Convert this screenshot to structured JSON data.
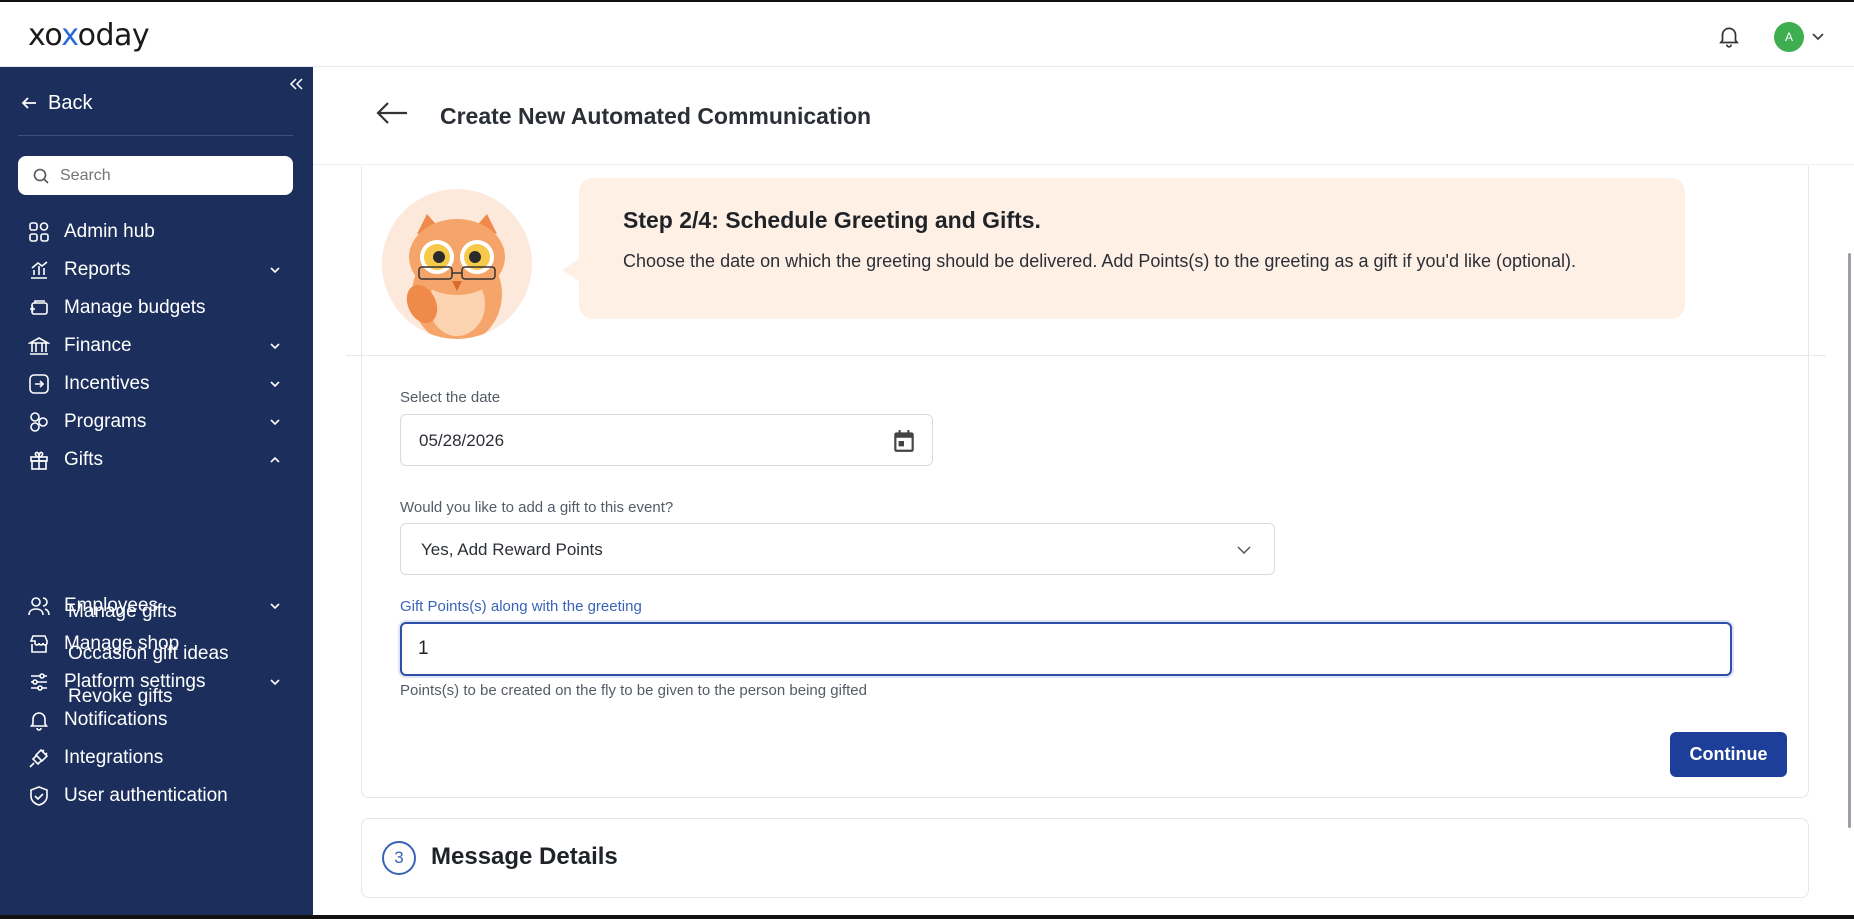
{
  "header": {
    "logo": {
      "pre": "xo",
      "x": "x",
      "post": "oday"
    },
    "avatar_initial": "A"
  },
  "sidebar": {
    "back_label": "Back",
    "search_placeholder": "Search",
    "items": [
      {
        "label": "Admin hub",
        "icon": "grid-icon",
        "chevron": ""
      },
      {
        "label": "Reports",
        "icon": "chart-icon",
        "chevron": "down"
      },
      {
        "label": "Manage budgets",
        "icon": "budget-icon",
        "chevron": ""
      },
      {
        "label": "Finance",
        "icon": "bank-icon",
        "chevron": "down"
      },
      {
        "label": "Incentives",
        "icon": "incentive-icon",
        "chevron": "down"
      },
      {
        "label": "Programs",
        "icon": "programs-icon",
        "chevron": "down"
      },
      {
        "label": "Gifts",
        "icon": "gift-icon",
        "chevron": "up"
      },
      {
        "label": "Employees",
        "icon": "employees-icon",
        "chevron": "down"
      },
      {
        "label": "Manage shop",
        "icon": "shop-icon",
        "chevron": ""
      },
      {
        "label": "Platform settings",
        "icon": "sliders-icon",
        "chevron": "down"
      },
      {
        "label": "Notifications",
        "icon": "bell-icon",
        "chevron": ""
      },
      {
        "label": "Integrations",
        "icon": "plug-icon",
        "chevron": ""
      },
      {
        "label": "User authentication",
        "icon": "shield-icon",
        "chevron": ""
      }
    ],
    "gift_subitems": [
      "Manage gifts",
      "Occasion gift ideas",
      "Revoke gifts"
    ]
  },
  "main": {
    "title": "Create New Automated Communication",
    "step": {
      "title": "Step 2/4: Schedule Greeting and Gifts.",
      "description": "Choose the date on which the greeting should be delivered. Add Points(s) to the greeting as a gift if you'd like (optional)."
    },
    "form": {
      "date_label": "Select the date",
      "date_value": "05/28/2026",
      "gift_question": "Would you like to add a gift to this event?",
      "gift_selected": "Yes, Add Reward Points",
      "points_label": "Gift Points(s) along with the greeting",
      "points_value": "1",
      "points_helper": "Points(s) to be created on the fly to be given to the person being gifted",
      "continue_label": "Continue"
    },
    "next_step": {
      "number": "3",
      "title": "Message Details"
    }
  },
  "colors": {
    "sidebar_bg": "#1c2f5c",
    "primary": "#1e3f99",
    "bubble_bg": "#fff0e6",
    "avatar_bg": "#3fae50"
  }
}
